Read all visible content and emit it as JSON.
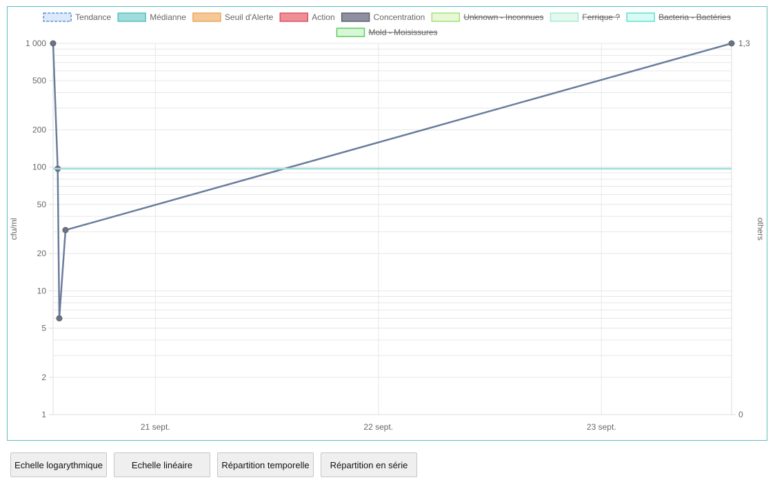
{
  "chart_data": {
    "type": "line",
    "legend": {
      "position": "top",
      "items": [
        {
          "label": "Tendance",
          "fill": "#dce9f8",
          "stroke": "#5b8fd8",
          "dashed": true,
          "hidden": false
        },
        {
          "label": "Médianne",
          "fill": "#9fdcdc",
          "stroke": "#5bbfbf",
          "dashed": false,
          "hidden": false
        },
        {
          "label": "Seuil d'Alerte",
          "fill": "#f5c896",
          "stroke": "#eaa760",
          "dashed": false,
          "hidden": false
        },
        {
          "label": "Action",
          "fill": "#ee8f98",
          "stroke": "#de5060",
          "dashed": false,
          "hidden": false
        },
        {
          "label": "Concentration",
          "fill": "#8e8f9f",
          "stroke": "#5f6170",
          "dashed": false,
          "hidden": false
        },
        {
          "label": "Unknown - Inconnues",
          "fill": "#e6f8d6",
          "stroke": "#a6e07a",
          "dashed": false,
          "hidden": true
        },
        {
          "label": "Ferrique ?",
          "fill": "#e3f8ef",
          "stroke": "#a6ecd0",
          "dashed": false,
          "hidden": true
        },
        {
          "label": "Bacteria - Bactéries",
          "fill": "#d8fbf6",
          "stroke": "#5ee0d0",
          "dashed": false,
          "hidden": true
        },
        {
          "label": "Mold - Moisissures",
          "fill": "#d8f6d8",
          "stroke": "#5ccc5c",
          "dashed": false,
          "hidden": true
        }
      ]
    },
    "y_left": {
      "label": "cfu/ml",
      "scale": "log",
      "range": [
        1,
        1000
      ],
      "ticks": [
        {
          "value": 1,
          "label": "1"
        },
        {
          "value": 2,
          "label": "2"
        },
        {
          "value": 5,
          "label": "5"
        },
        {
          "value": 10,
          "label": "10"
        },
        {
          "value": 20,
          "label": "20"
        },
        {
          "value": 50,
          "label": "50"
        },
        {
          "value": 100,
          "label": "100"
        },
        {
          "value": 200,
          "label": "200"
        },
        {
          "value": 500,
          "label": "500"
        },
        {
          "value": 1000,
          "label": "1 000"
        }
      ]
    },
    "y_right": {
      "label": "others",
      "range": [
        0,
        1.3
      ],
      "ticks": [
        {
          "value": 0,
          "label": "0"
        },
        {
          "value": 1.3,
          "label": "1,3"
        }
      ]
    },
    "x": {
      "type": "time",
      "range": [
        "2024-09-20T13:00",
        "2024-09-23T14:00"
      ],
      "ticks": [
        {
          "value": "2024-09-21T00:00",
          "label": "21 sept."
        },
        {
          "value": "2024-09-22T00:00",
          "label": "22 sept."
        },
        {
          "value": "2024-09-23T00:00",
          "label": "23 sept."
        }
      ],
      "grid": true
    },
    "series": [
      {
        "name": "Concentration",
        "color": "#6a7c9c",
        "points": [
          {
            "x": "2024-09-20T13:00",
            "y": 1000
          },
          {
            "x": "2024-09-20T13:30",
            "y": 97
          },
          {
            "x": "2024-09-20T13:40",
            "y": 6
          },
          {
            "x": "2024-09-20T14:20",
            "y": 31
          },
          {
            "x": "2024-09-23T14:00",
            "y": 1000
          }
        ]
      },
      {
        "name": "Médianne",
        "color": "#9fdcdc",
        "points": [
          {
            "x": "2024-09-20T13:00",
            "y": 97
          },
          {
            "x": "2024-09-23T14:00",
            "y": 97
          }
        ]
      }
    ]
  },
  "buttons": [
    {
      "id": "log",
      "label": "Echelle logarythmique"
    },
    {
      "id": "lin",
      "label": "Echelle linéaire"
    },
    {
      "id": "time",
      "label": "Répartition temporelle"
    },
    {
      "id": "serie",
      "label": "Répartition en série"
    }
  ]
}
